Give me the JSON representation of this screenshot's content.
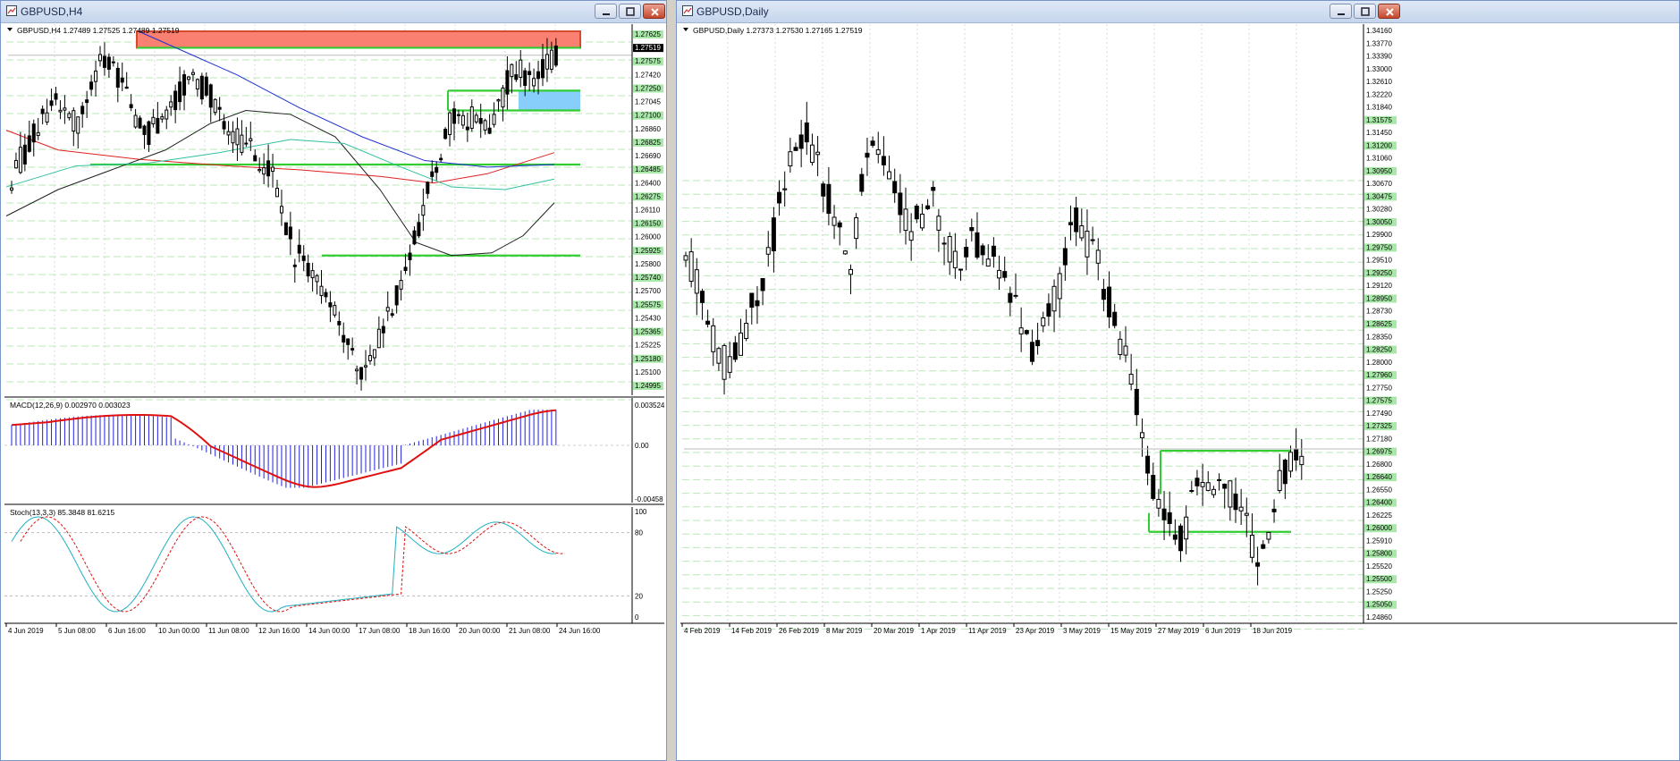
{
  "windows": {
    "left": {
      "title": "GBPUSD,H4"
    },
    "right": {
      "title": "GBPUSD,Daily"
    }
  },
  "left_chart": {
    "header": "GBPUSD,H4  1.27489 1.27525 1.27489 1.27519",
    "price_labels": [
      "1.27625",
      "1.27519",
      "1.27575",
      "1.27420",
      "1.27250",
      "1.27045",
      "1.27100",
      "1.26860",
      "1.26825",
      "1.26690",
      "1.26485",
      "1.26400",
      "1.26275",
      "1.26110",
      "1.26150",
      "1.26000",
      "1.25925",
      "1.25800",
      "1.25740",
      "1.25700",
      "1.25575",
      "1.25430",
      "1.25365",
      "1.25225",
      "1.25180",
      "1.25100",
      "1.24995"
    ],
    "time_labels": [
      "4 Jun 2019",
      "5 Jun 08:00",
      "6 Jun 16:00",
      "10 Jun 00:00",
      "11 Jun 08:00",
      "12 Jun 16:00",
      "14 Jun 00:00",
      "17 Jun 08:00",
      "18 Jun 16:00",
      "20 Jun 00:00",
      "21 Jun 08:00",
      "24 Jun 16:00"
    ],
    "macd": {
      "header": "MACD(12,26,9) 0.002970 0.003023",
      "scale": [
        "0.003524",
        "0.00",
        "-0.00458"
      ]
    },
    "stoch": {
      "header": "Stoch(13,3,3) 85.3848 81.6215",
      "scale": [
        "100",
        "80",
        "20",
        "0"
      ]
    }
  },
  "right_chart": {
    "header": "GBPUSD,Daily  1.27373 1.27530 1.27165 1.27519",
    "price_labels": [
      "1.34160",
      "1.33770",
      "1.33390",
      "1.33000",
      "1.32610",
      "1.32220",
      "1.31840",
      "1.31575",
      "1.31450",
      "1.31200",
      "1.31060",
      "1.30950",
      "1.30670",
      "1.30475",
      "1.30280",
      "1.30050",
      "1.29900",
      "1.29750",
      "1.29510",
      "1.29250",
      "1.29120",
      "1.28950",
      "1.28730",
      "1.28625",
      "1.28350",
      "1.28250",
      "1.28000",
      "1.27960",
      "1.27750",
      "1.27575",
      "1.27490",
      "1.27325",
      "1.27180",
      "1.26975",
      "1.26800",
      "1.26640",
      "1.26550",
      "1.26400",
      "1.26225",
      "1.26000",
      "1.25910",
      "1.25800",
      "1.25520",
      "1.25500",
      "1.25250",
      "1.25050",
      "1.24860"
    ],
    "time_labels": [
      "4 Feb 2019",
      "14 Feb 2019",
      "26 Feb 2019",
      "8 Mar 2019",
      "20 Mar 2019",
      "1 Apr 2019",
      "11 Apr 2019",
      "23 Apr 2019",
      "3 May 2019",
      "15 May 2019",
      "27 May 2019",
      "6 Jun 2019",
      "18 Jun 2019"
    ]
  },
  "colors": {
    "bull": "#ffffff",
    "bear": "#000000",
    "zone_red": "#fa8072",
    "zone_blue": "#87cefa",
    "level": "#32cd32",
    "grid": "#b8e8b8",
    "ma_red": "#e02020",
    "ma_blue": "#2030d0",
    "ma_black": "#202020",
    "ma_aqua": "#30c0a0",
    "macd_hist": "#2020e0",
    "macd_signal": "#e01010",
    "stoch_main": "#20b0c0",
    "stoch_signal": "#e01010"
  },
  "icons": {
    "window": "chart-window-icon",
    "minimize": "minimize-icon",
    "maximize": "maximize-icon",
    "close": "close-icon"
  }
}
